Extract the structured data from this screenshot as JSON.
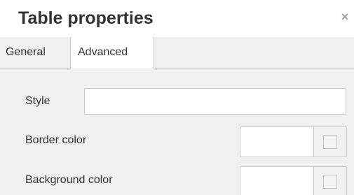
{
  "dialog": {
    "title": "Table properties",
    "close_glyph": "×",
    "close_icon": "close-icon"
  },
  "tabs": [
    {
      "label": "General",
      "active": false
    },
    {
      "label": "Advanced",
      "active": true
    }
  ],
  "fields": {
    "style": {
      "label": "Style",
      "value": ""
    },
    "border_color": {
      "label": "Border color",
      "value": ""
    },
    "background_color": {
      "label": "Background color",
      "value": ""
    }
  },
  "colors": {
    "panel_bg": "#f0f0f0",
    "border": "#c5c5c5",
    "text": "#333333"
  }
}
